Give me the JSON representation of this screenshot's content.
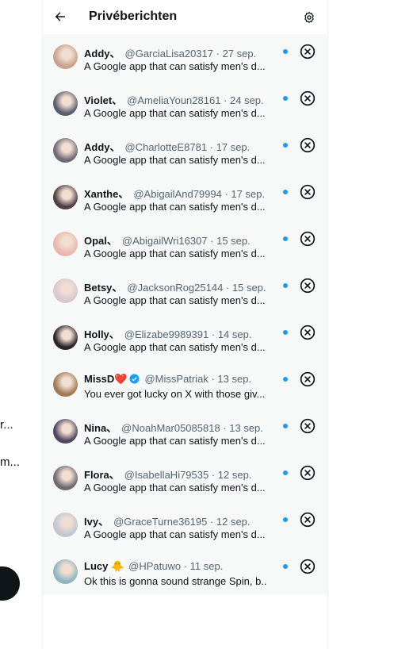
{
  "background": {
    "fragment1": "r...",
    "fragment2": "m..."
  },
  "header": {
    "title": "Privéberichten",
    "back_icon": "arrow-left-icon",
    "settings_icon": "gear-icon"
  },
  "conversations": [
    {
      "name": "Addy、",
      "handle": "@GarciaLisa20317",
      "date": "27 sep.",
      "preview": "A Google app that can satisfy men's d...",
      "avatar_color": "#c9a28c"
    },
    {
      "name": "Violet、",
      "handle": "@AmeliaYoun28161",
      "date": "24 sep.",
      "preview": "A Google app that can satisfy men's d...",
      "avatar_color": "#5b5f6d"
    },
    {
      "name": "Addy、",
      "handle": "@CharlotteE8781",
      "date": "17 sep.",
      "preview": "A Google app that can satisfy men's d...",
      "avatar_color": "#6f6a72"
    },
    {
      "name": "Xanthe、",
      "handle": "@AbigailAnd79994",
      "date": "17 sep.",
      "preview": "A Google app that can satisfy men's d...",
      "avatar_color": "#4e3f42"
    },
    {
      "name": "Opal、",
      "handle": "@AbigailWri16307",
      "date": "15 sep.",
      "preview": "A Google app that can satisfy men's d...",
      "avatar_color": "#e9b7ae"
    },
    {
      "name": "Betsy、",
      "handle": "@JacksonRog25144",
      "date": "15 sep.",
      "preview": "A Google app that can satisfy men's d...",
      "avatar_color": "#d7c8d0"
    },
    {
      "name": "Holly、",
      "handle": "@Elizabe9989391",
      "date": "14 sep.",
      "preview": "A Google app that can satisfy men's d...",
      "avatar_color": "#2b2429"
    },
    {
      "name": "MissD❤️",
      "handle": "@MissPatriak",
      "date": "13 sep.",
      "preview": "You ever got lucky on X with those giv...",
      "avatar_color": "#a07a52",
      "verified": true
    },
    {
      "name": "Nina、",
      "handle": "@NoahMar05085818",
      "date": "13 sep.",
      "preview": "A Google app that can satisfy men's d...",
      "avatar_color": "#504660"
    },
    {
      "name": "Flora、",
      "handle": "@IsabellaHi79535",
      "date": "12 sep.",
      "preview": "A Google app that can satisfy men's d...",
      "avatar_color": "#6d6a70"
    },
    {
      "name": "Ivy、",
      "handle": "@GraceTurne36195",
      "date": "12 sep.",
      "preview": "A Google app that can satisfy men's d...",
      "avatar_color": "#c3c6cf"
    },
    {
      "name": "Lucy 🐥",
      "handle": "@HPatuwo",
      "date": "11 sep.",
      "preview": "Ok this is gonna sound strange Spin, b...",
      "avatar_color": "#8fb6c0"
    }
  ],
  "separator": " · ",
  "colors": {
    "accent": "#1d9bf0",
    "list_background": "#f7f9f9",
    "secondary_text": "#536471"
  },
  "icons": {
    "row_close": "close-circle-icon",
    "unread": "unread-dot-icon",
    "verified": "verified-badge-icon"
  }
}
